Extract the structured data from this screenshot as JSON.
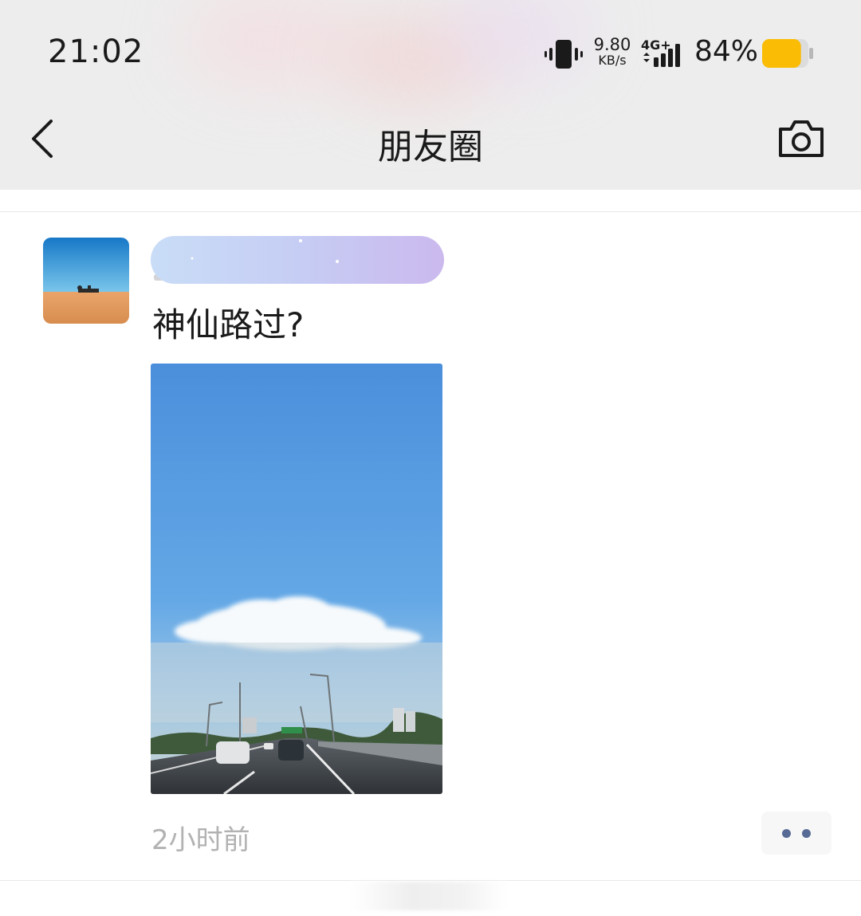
{
  "status_bar": {
    "time": "21:02",
    "net_speed_value": "9.80",
    "net_speed_unit": "KB/s",
    "network_type": "4G+",
    "battery_percent": "84%",
    "battery_level": 0.84,
    "battery_color": "#fbbc05"
  },
  "nav": {
    "title": "朋友圈",
    "back_icon": "chevron-left-icon",
    "camera_icon": "camera-icon"
  },
  "post": {
    "author_name_redacted": true,
    "text": "神仙路过?",
    "time_ago": "2小时前",
    "more_icon": "more-dots-icon",
    "link_color": "#576b95"
  }
}
